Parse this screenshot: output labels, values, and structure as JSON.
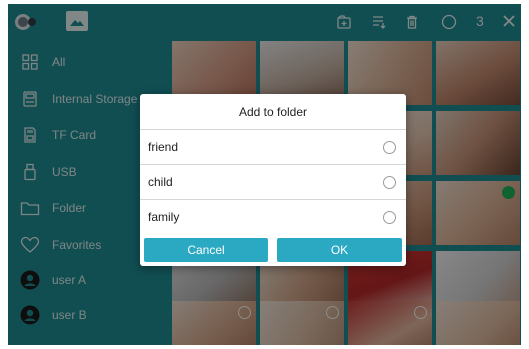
{
  "colors": {
    "teal": "#1f8f95",
    "dialog_button": "#2ba8c2"
  },
  "topbar": {
    "count": "3",
    "icons": [
      "app-logo-icon",
      "gallery-icon",
      "add-to-folder-icon",
      "sort-icon",
      "delete-icon",
      "select-circle-icon",
      "close-icon"
    ]
  },
  "sidebar": {
    "items": [
      {
        "label": "All",
        "icon": "grid-icon"
      },
      {
        "label": "Internal Storage",
        "icon": "storage-icon"
      },
      {
        "label": "TF Card",
        "icon": "sd-card-icon"
      },
      {
        "label": "USB",
        "icon": "usb-icon"
      },
      {
        "label": "Folder",
        "icon": "folder-icon"
      },
      {
        "label": "Favorites",
        "icon": "heart-icon"
      },
      {
        "label": "user A",
        "icon": "user-avatar-icon"
      },
      {
        "label": "user B",
        "icon": "user-avatar-icon"
      }
    ]
  },
  "dialog": {
    "title": "Add to folder",
    "options": [
      {
        "label": "friend",
        "selected": false
      },
      {
        "label": "child",
        "selected": false
      },
      {
        "label": "family",
        "selected": false
      }
    ],
    "cancel_label": "Cancel",
    "ok_label": "OK"
  }
}
